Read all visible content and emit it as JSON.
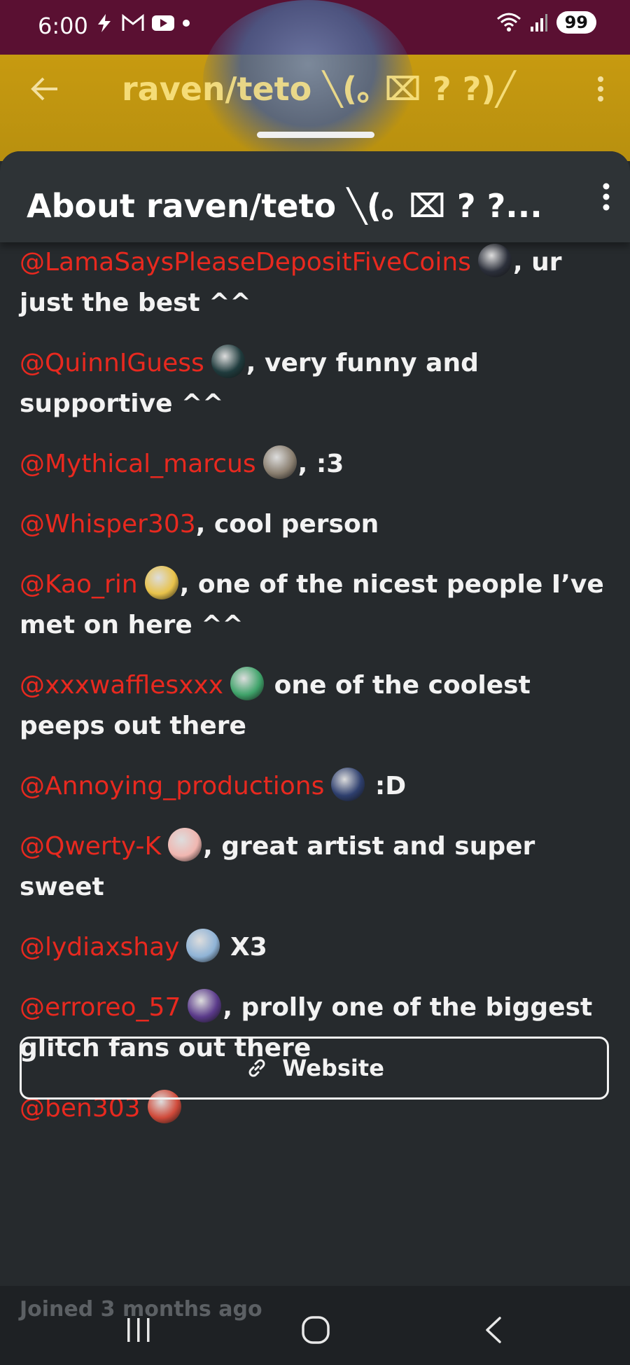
{
  "status_bar": {
    "time": "6:00",
    "battery": "99"
  },
  "background_header": {
    "title": "raven/teto ╲(｡ ⌧ ? ?)╱",
    "colors": {
      "top": "#5a1032",
      "banner": "#c79a10"
    }
  },
  "sheet": {
    "title": "About raven/teto ╲(｡ ⌧ ? ?...",
    "entries": [
      {
        "mention": "@LamaSaysPleaseDepositFiveCoins",
        "text": ", ur just the best ^^",
        "avatar_color": "#2b2f3a"
      },
      {
        "mention": "@QuinnIGuess",
        "text": ", very funny and supportive ^^",
        "avatar_color": "#1f3b3d"
      },
      {
        "mention": "@Mythical_marcus",
        "text": ", :3",
        "avatar_color": "#8a7f70"
      },
      {
        "mention": "@Whisper303",
        "text": ", cool person",
        "avatar_color": ""
      },
      {
        "mention": "@Kao_rin",
        "text": ", one of the nicest people I’ve met on here ^^",
        "avatar_color": "#e8c24a"
      },
      {
        "mention": "@xxxwafflesxxx",
        "text": " one of the coolest peeps out there",
        "avatar_color": "#3fa36a"
      },
      {
        "mention": "@Annoying_productions",
        "text": " :D",
        "avatar_color": "#2e3f6e"
      },
      {
        "mention": "@Qwerty-K",
        "text": ", great artist and super sweet",
        "avatar_color": "#f0b6b0"
      },
      {
        "mention": "@lydiaxshay",
        "text": " X3",
        "avatar_color": "#8fb3d6"
      },
      {
        "mention": "@erroreo_57",
        "text": ", prolly one of the biggest glitch fans out there",
        "avatar_color": "#5a3a8a"
      },
      {
        "mention": "@ben303",
        "text": "",
        "avatar_color": "#d04a3a"
      }
    ],
    "website_label": "Website",
    "joined_label": "Joined 3 months ago"
  },
  "colors": {
    "mention": "#e8291f",
    "sheet_bg": "#262a2d",
    "text": "#f2f2f2"
  },
  "icons": {
    "back": "arrow-left-icon",
    "menu": "more-vertical-icon",
    "link": "link-icon",
    "nav_recents": "recents-icon",
    "nav_home": "home-icon",
    "nav_back": "nav-back-icon"
  }
}
